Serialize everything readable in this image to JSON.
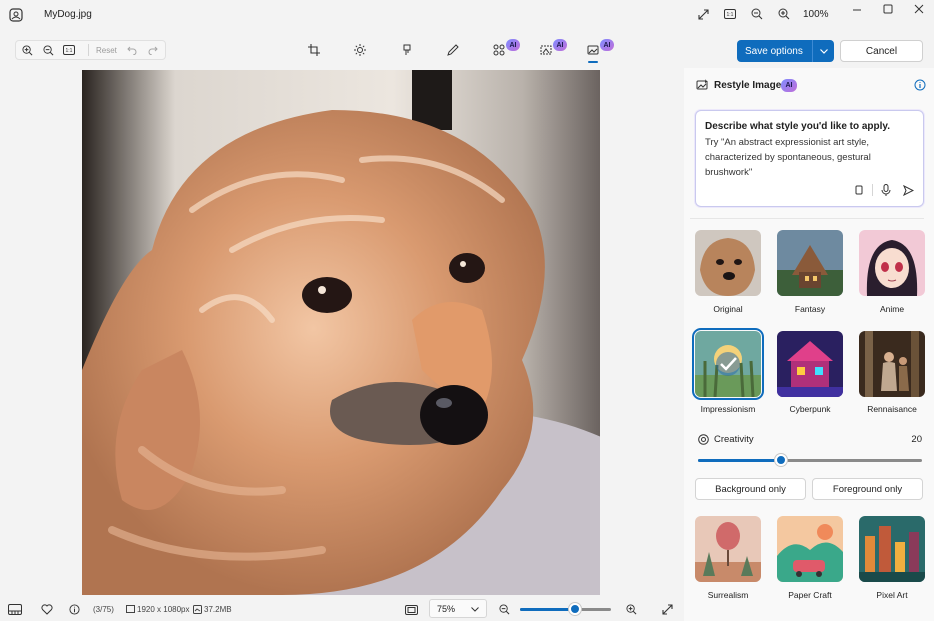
{
  "titlebar": {
    "file_name": "MyDog.jpg",
    "zoom_label": "100%",
    "icons": [
      "photos-app-icon",
      "expand-icon",
      "fit-icon",
      "zoom-out-icon",
      "zoom-in-icon",
      "minimize-icon",
      "maximize-icon",
      "close-icon"
    ]
  },
  "edit_toolbar": {
    "reset_label": "Reset",
    "ai_badge": "AI",
    "tools": [
      "crop-icon",
      "adjust-icon",
      "markup-icon",
      "draw-icon",
      "object-remove-icon",
      "background-icon",
      "restyle-icon"
    ]
  },
  "actions": {
    "save_label": "Save options",
    "cancel_label": "Cancel"
  },
  "panel": {
    "title": "Restyle Image",
    "ai_badge": "AI",
    "prompt_heading": "Describe what style you'd like to apply.",
    "prompt_hint": "Try \"An abstract expressionist art style, characterized by spontaneous, gestural brushwork\"",
    "styles_row1": [
      {
        "label": "Original"
      },
      {
        "label": "Fantasy"
      },
      {
        "label": "Anime"
      }
    ],
    "styles_row2": [
      {
        "label": "Impressionism"
      },
      {
        "label": "Cyberpunk"
      },
      {
        "label": "Rennaisance"
      }
    ],
    "styles_row3": [
      {
        "label": "Surrealism"
      },
      {
        "label": "Paper Craft"
      },
      {
        "label": "Pixel Art"
      }
    ],
    "selected_style": "Impressionism",
    "creativity_label": "Creativity",
    "creativity_value": "20",
    "creativity_fraction": 0.37,
    "background_only_label": "Background only",
    "foreground_only_label": "Foreground only"
  },
  "statusbar": {
    "position": "(3/75)",
    "resolution": "1920 x 1080px",
    "file_size": "37.2MB",
    "zoom_value": "75%",
    "zoom_fraction": 0.6
  },
  "colors": {
    "accent": "#0f6cbd",
    "ai_gradient_start": "#7f8cff",
    "ai_gradient_end": "#c06dd8"
  }
}
